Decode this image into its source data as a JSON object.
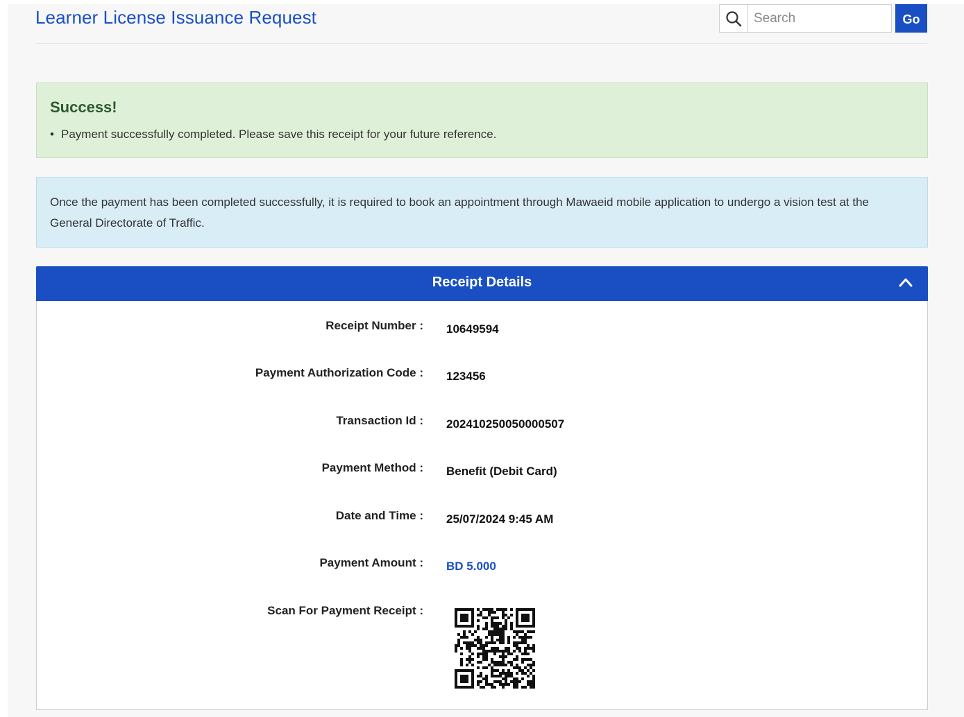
{
  "header": {
    "title": "Learner License Issuance Request",
    "search_placeholder": "Search",
    "go_label": "Go"
  },
  "success_alert": {
    "heading": "Success!",
    "messages": [
      "Payment successfully completed. Please save this receipt for your future reference."
    ]
  },
  "info_alert": {
    "text": "Once the payment has been completed successfully, it is required to book an appointment through Mawaeid mobile application to undergo a vision test at the General Directorate of Traffic."
  },
  "receipt": {
    "title": "Receipt Details",
    "rows": [
      {
        "label": "Receipt Number :",
        "value": "10649594"
      },
      {
        "label": "Payment Authorization Code :",
        "value": "123456"
      },
      {
        "label": "Transaction Id :",
        "value": "202410250050000507"
      },
      {
        "label": "Payment Method :",
        "value": "Benefit (Debit Card)"
      },
      {
        "label": "Date and Time :",
        "value": "25/07/2024 9:45 AM"
      },
      {
        "label": "Payment Amount :",
        "value": "BD 5.000"
      },
      {
        "label": "Scan For Payment Receipt :",
        "value": ""
      }
    ]
  },
  "colors": {
    "brand": "#1a4fc4",
    "success_bg": "#dff0d8",
    "info_bg": "#d9edf7"
  },
  "icons": {
    "search": "search-icon",
    "collapse": "chevron-up-icon",
    "qr": "qr-code-icon"
  }
}
